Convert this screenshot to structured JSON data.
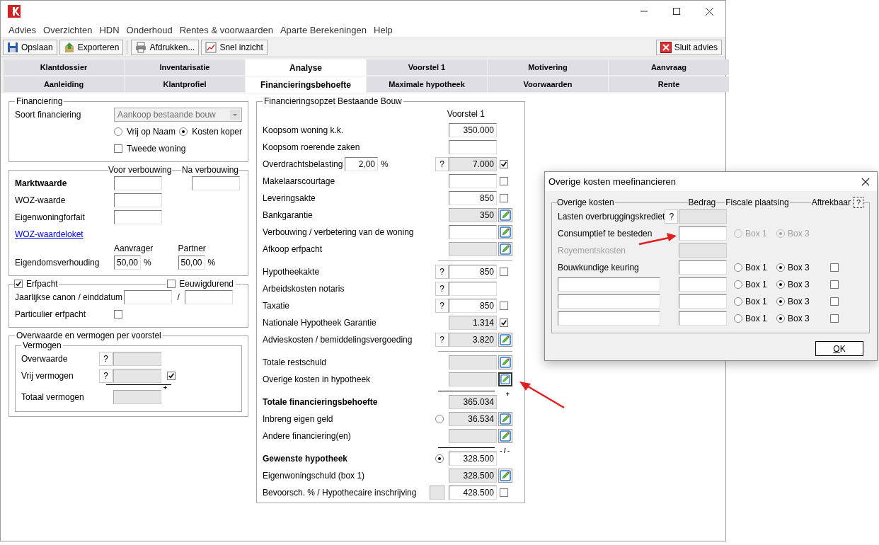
{
  "menu": [
    "Advies",
    "Overzichten",
    "HDN",
    "Onderhoud",
    "Rentes & voorwaarden",
    "Aparte Berekeningen",
    "Help"
  ],
  "toolbar": {
    "left": [
      {
        "label": "Opslaan"
      },
      {
        "label": "Exporteren"
      },
      {
        "label": "Afdrukken..."
      },
      {
        "label": "Snel inzicht"
      }
    ],
    "right": {
      "label": "Sluit advies"
    }
  },
  "tabs": [
    [
      {
        "label": "Klantdossier",
        "selected": false
      },
      {
        "label": "Inventarisatie",
        "selected": false
      },
      {
        "label": "Analyse",
        "selected": true
      },
      {
        "label": "Voorstel 1",
        "selected": false
      },
      {
        "label": "Motivering",
        "selected": false
      },
      {
        "label": "Aanvraag",
        "selected": false
      }
    ],
    [
      {
        "label": "Aanleiding",
        "selected": false
      },
      {
        "label": "Klantprofiel",
        "selected": false
      },
      {
        "label": "Financieringsbehoefte",
        "selected": true
      },
      {
        "label": "Maximale hypotheek",
        "selected": false
      },
      {
        "label": "Voorwaarden",
        "selected": false
      },
      {
        "label": "Rente",
        "selected": false
      }
    ]
  ],
  "financiering": {
    "title": "Financiering",
    "type_label": "Soort financiering",
    "type_value": "Aankoop bestaande bouw",
    "type_disabled": true,
    "radios": [
      {
        "label": "Vrij op Naam",
        "selected": false
      },
      {
        "label": "Kosten koper",
        "selected": true
      }
    ],
    "second_home": {
      "label": "Tweede woning",
      "checked": false
    }
  },
  "valuation": {
    "headings": [
      "Voor verbouwing",
      "Na verbouwing"
    ],
    "rows": [
      {
        "label": "Marktwaarde",
        "bold": true,
        "second_field": true
      },
      {
        "label": "WOZ-waarde",
        "bold": false,
        "second_field": false
      },
      {
        "label": "Eigenwoningforfait",
        "bold": false,
        "second_field": false
      }
    ],
    "link": "WOZ-waardeloket",
    "ownership": {
      "label": "Eigendomsverhouding",
      "columns": [
        {
          "heading": "Aanvrager",
          "value": "50,00",
          "unit": "%"
        },
        {
          "heading": "Partner",
          "value": "50,00",
          "unit": "%"
        }
      ]
    }
  },
  "erfpacht": {
    "label": "Erfpacht",
    "checked": true,
    "perpetual": {
      "label": "Eeuwigdurend",
      "checked": false
    },
    "canon_label": "Jaarlijkse canon / einddatum",
    "separator": "/",
    "private": {
      "label": "Particulier erfpacht",
      "checked": false
    }
  },
  "surplus": {
    "title": "Overwaarde en vermogen per voorstel",
    "group": "Vermogen",
    "rows": [
      {
        "kind": "line",
        "label": "Overwaarde",
        "help": "?",
        "readonly": true
      },
      {
        "kind": "line",
        "label": "Vrij vermogen",
        "help": "?",
        "readonly": true,
        "checked": true
      },
      {
        "kind": "rule",
        "sign": "+"
      },
      {
        "kind": "line",
        "label": "Totaal vermogen",
        "readonly": true
      }
    ]
  },
  "financing": {
    "title": "Financieringsopzet Bestaande Bouw",
    "column": "Voorstel 1",
    "rows": [
      {
        "kind": "line",
        "label": "Koopsom woning k.k.",
        "value": "350.000",
        "readonly": false
      },
      {
        "kind": "line",
        "label": "Koopsom roerende zaken",
        "readonly": false
      },
      {
        "kind": "line",
        "label": "Overdrachtsbelasting",
        "percent": {
          "value": "2,00",
          "unit": "%"
        },
        "help": "?",
        "value": "7.000",
        "readonly": true,
        "checked": true
      },
      {
        "kind": "line",
        "label": "Makelaarscourtage",
        "readonly": false,
        "checked": false
      },
      {
        "kind": "line",
        "label": "Leveringsakte",
        "value": "850",
        "readonly": false,
        "checked": false
      },
      {
        "kind": "line",
        "label": "Bankgarantie",
        "value": "350",
        "readonly": true,
        "editable": true
      },
      {
        "kind": "line",
        "label": "Verbouwing / verbetering van de woning",
        "readonly": false,
        "editable": true
      },
      {
        "kind": "line",
        "label": "Afkoop erfpacht",
        "readonly": true,
        "editable": true
      },
      {
        "kind": "rule"
      },
      {
        "kind": "line",
        "label": "Hypotheekakte",
        "help": "?",
        "value": "850",
        "readonly": false,
        "checked": false
      },
      {
        "kind": "line",
        "label": "Arbeidskosten notaris",
        "help": "?",
        "readonly": false
      },
      {
        "kind": "line",
        "label": "Taxatie",
        "help": "?",
        "value": "850",
        "readonly": false,
        "checked": false
      },
      {
        "kind": "line",
        "label": "Nationale Hypotheek Garantie",
        "value": "1.314",
        "readonly": true,
        "checked": true
      },
      {
        "kind": "line",
        "label": "Advieskosten / bemiddelingsvergoeding",
        "help": "?",
        "value": "3.820",
        "readonly": true,
        "editable": true
      },
      {
        "kind": "rule"
      },
      {
        "kind": "line",
        "label": "Totale restschuld",
        "readonly": true,
        "editable": true
      },
      {
        "kind": "line",
        "label": "Overige kosten in hypotheek",
        "readonly": true,
        "editable": true,
        "focused": true
      },
      {
        "kind": "rule",
        "sign": "+"
      },
      {
        "kind": "line",
        "label": "Totale financieringsbehoefte",
        "bold": true,
        "value": "365.034",
        "readonly": true
      },
      {
        "kind": "line",
        "label": "Inbreng eigen geld",
        "radio": {
          "selected": false
        },
        "value": "36.534",
        "readonly": true,
        "editable": true
      },
      {
        "kind": "line",
        "label": "Andere financiering(en)",
        "readonly": true,
        "editable": true
      },
      {
        "kind": "rule",
        "sign": "- / -"
      },
      {
        "kind": "line",
        "label": "Gewenste hypotheek",
        "bold": true,
        "radio": {
          "selected": true
        },
        "value": "328.500",
        "readonly": false
      },
      {
        "kind": "line",
        "label": "Eigenwoningschuld (box 1)",
        "value": "328.500",
        "readonly": true,
        "editable": true
      },
      {
        "kind": "line",
        "label": "Bevoorsch. % / Hypothecaire inschrijving",
        "pre_field": {
          "readonly": true
        },
        "value": "428.500",
        "readonly": false,
        "checked": false
      }
    ]
  },
  "dialog": {
    "title": "Overige kosten meefinancieren",
    "legend": "Overige kosten",
    "headings": [
      "Bedrag",
      "Fiscale plaatsing",
      "Aftrekbaar"
    ],
    "help": "?",
    "rows": [
      {
        "kind": "label",
        "label": "Lasten overbruggingskrediet",
        "disabled": false,
        "help": "?",
        "readonly": true
      },
      {
        "kind": "label",
        "label": "Consumptief te besteden",
        "disabled": false,
        "readonly": false,
        "radios": {
          "disabled": true,
          "options": [
            {
              "label": "Box 1",
              "selected": false
            },
            {
              "label": "Box 3",
              "selected": true
            }
          ]
        }
      },
      {
        "kind": "label",
        "label": "Royementskosten",
        "disabled": true,
        "readonly": true
      },
      {
        "kind": "label",
        "label": "Bouwkundige keuring",
        "disabled": false,
        "readonly": false,
        "radios": {
          "disabled": false,
          "options": [
            {
              "label": "Box 1",
              "selected": false
            },
            {
              "label": "Box 3",
              "selected": true
            }
          ]
        },
        "deductible": false
      },
      {
        "kind": "input",
        "readonly": false,
        "radios": {
          "disabled": false,
          "options": [
            {
              "label": "Box 1",
              "selected": false
            },
            {
              "label": "Box 3",
              "selected": true
            }
          ]
        },
        "deductible": false
      },
      {
        "kind": "input",
        "readonly": false,
        "radios": {
          "disabled": false,
          "options": [
            {
              "label": "Box 1",
              "selected": false
            },
            {
              "label": "Box 3",
              "selected": true
            }
          ]
        },
        "deductible": false
      },
      {
        "kind": "input",
        "readonly": false,
        "radios": {
          "disabled": false,
          "options": [
            {
              "label": "Box 1",
              "selected": false
            },
            {
              "label": "Box 3",
              "selected": true
            }
          ]
        },
        "deductible": false
      }
    ],
    "ok": "OK"
  }
}
